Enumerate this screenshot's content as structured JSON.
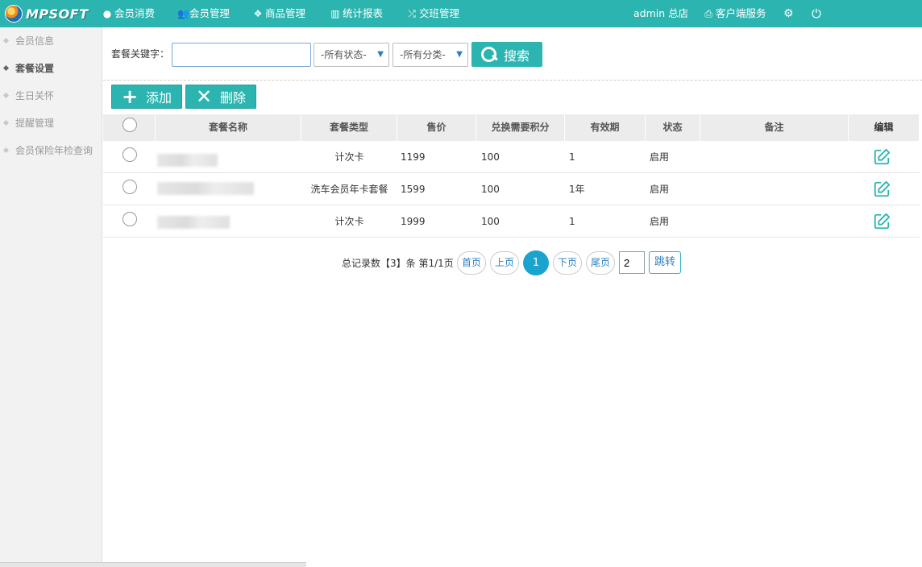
{
  "brand": {
    "logo_text": "MPSOFT"
  },
  "topnav": {
    "items": [
      {
        "label": "会员消费",
        "icon": "user-circle-icon"
      },
      {
        "label": "会员管理",
        "icon": "users-icon"
      },
      {
        "label": "商品管理",
        "icon": "cubes-icon"
      },
      {
        "label": "统计报表",
        "icon": "bar-chart-icon"
      },
      {
        "label": "交班管理",
        "icon": "shuffle-icon"
      }
    ],
    "admin_label": "admin 总店",
    "service_label": "客户端服务",
    "accent_color": "#2cb5b0"
  },
  "sidebar": {
    "items": [
      {
        "label": "会员信息"
      },
      {
        "label": "套餐设置"
      },
      {
        "label": "生日关怀"
      },
      {
        "label": "提醒管理"
      },
      {
        "label": "会员保险年检查询"
      }
    ],
    "active": "套餐设置"
  },
  "search": {
    "label": "套餐关键字：",
    "value": "",
    "placeholder": "",
    "status_select": "-所有状态-",
    "category_select": "-所有分类-",
    "button_label": "搜索"
  },
  "actions": {
    "add_label": "添加",
    "delete_label": "删除"
  },
  "table": {
    "columns": [
      "套餐名称",
      "套餐类型",
      "售价",
      "兑换需要积分",
      "有效期",
      "状态",
      "备注",
      "编辑"
    ],
    "rows": [
      {
        "name": "",
        "type": "计次卡",
        "price": "1199",
        "points": "100",
        "validity": "1",
        "status": "启用",
        "note": ""
      },
      {
        "name": "",
        "type": "洗车会员年卡套餐",
        "price": "1599",
        "points": "100",
        "validity": "1年",
        "status": "启用",
        "note": ""
      },
      {
        "name": "",
        "type": "计次卡",
        "price": "1999",
        "points": "100",
        "validity": "1",
        "status": "启用",
        "note": ""
      }
    ]
  },
  "pagination": {
    "summary": "总记录数【3】条 第1/1页",
    "first": "首页",
    "prev": "上页",
    "current": "1",
    "next": "下页",
    "last": "尾页",
    "jump_value": "2",
    "go_label": "跳转"
  }
}
